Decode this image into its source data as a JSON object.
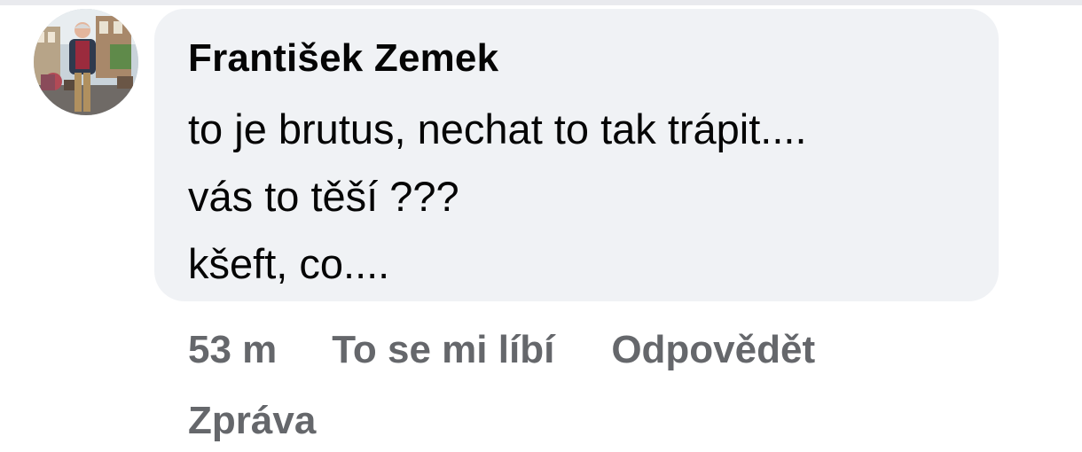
{
  "comment": {
    "author": "František Zemek",
    "lines": [
      "to je brutus, nechat to tak trápit....",
      "vás to těší ???",
      "kšeft, co...."
    ]
  },
  "actions": {
    "timestamp": "53 m",
    "like": "To se mi líbí",
    "reply": "Odpovědět",
    "message": "Zpráva"
  },
  "colors": {
    "bubble_bg": "#f0f2f5",
    "text_primary": "#050505",
    "text_secondary": "#65676b"
  }
}
